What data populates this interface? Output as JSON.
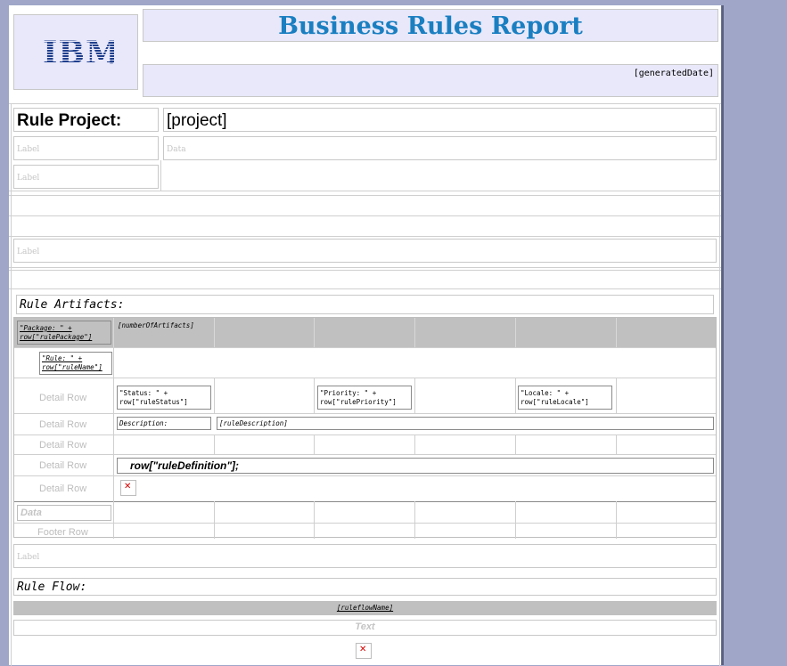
{
  "header": {
    "logo_text": "IBM",
    "title": "Business Rules Report",
    "generated_date": "[generatedDate]"
  },
  "project_section": {
    "label": "Rule Project:",
    "value": "[project]",
    "label_placeholder_1": "Label",
    "data_placeholder": "Data",
    "label_placeholder_2": "Label",
    "label_placeholder_3": "Label"
  },
  "artifacts": {
    "heading": "Rule Artifacts:",
    "group_header": "\"Package: \" + row[\"rulePackage\"]",
    "number_of_artifacts": "[numberOfArtifacts]",
    "rule_name": "\"Rule: \" + row[\"ruleName\"]",
    "detail_row_label": "Detail Row",
    "status": "\"Status: \" + row[\"ruleStatus\"]",
    "priority": "\"Priority: \" + row[\"rulePriority\"]",
    "locale": "\"Locale: \" + row[\"ruleLocale\"]",
    "description_label": "Description:",
    "description_value": "[ruleDescription]",
    "rule_definition": "row[\"ruleDefinition\"];",
    "data_placeholder": "Data",
    "footer_row_label": "Footer Row",
    "label_placeholder": "Label"
  },
  "rule_flow": {
    "heading": "Rule Flow:",
    "ruleflow_name": "[ruleflowName]",
    "text_placeholder": "Text"
  },
  "colors": {
    "title_blue": "#1a7fc1",
    "ibm_blue": "#1f3f8c",
    "background": "#9fa6c8",
    "header_fill": "#e8e8fa",
    "group_header_gray": "#c0c0c0"
  },
  "icons": [
    "broken-image-icon"
  ]
}
